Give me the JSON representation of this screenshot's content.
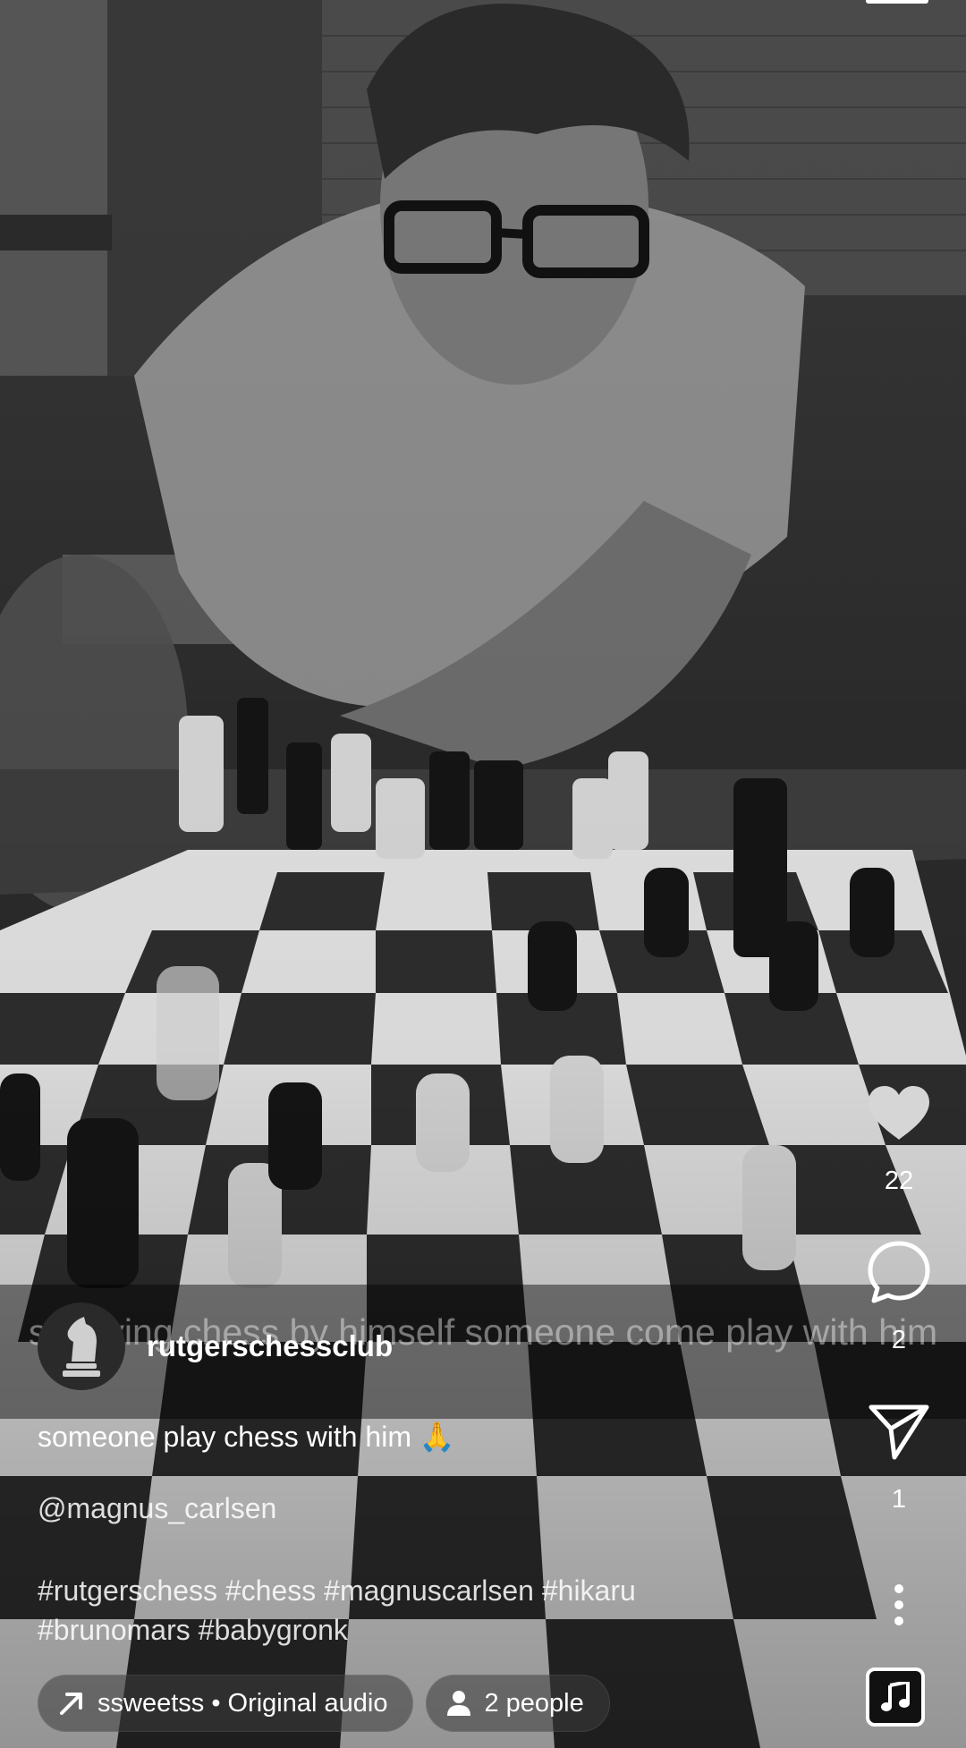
{
  "video": {
    "caption": "s playing chess by himself someone come play with him"
  },
  "rail": {
    "like_count": "22",
    "comment_count": "2",
    "share_count": "1"
  },
  "account": {
    "username": "rutgerschessclub"
  },
  "post": {
    "description": "someone play chess with him 🙏",
    "mention": "@magnus_carlsen",
    "hashtags_line1": "#rutgerschess #chess #magnuscarlsen #hikaru",
    "hashtags_line2": "#brunomars #babygronk"
  },
  "chips": {
    "audio": "ssweetss • Original audio",
    "people": "2 people"
  },
  "icons": {
    "like": "heart-icon",
    "comment": "comment-bubble-icon",
    "share": "paper-plane-icon",
    "more": "more-vertical-icon",
    "audio": "music-note-icon",
    "audio_chip": "arrow-up-right-icon",
    "people_chip": "person-icon",
    "avatar": "chess-knight-icon"
  }
}
